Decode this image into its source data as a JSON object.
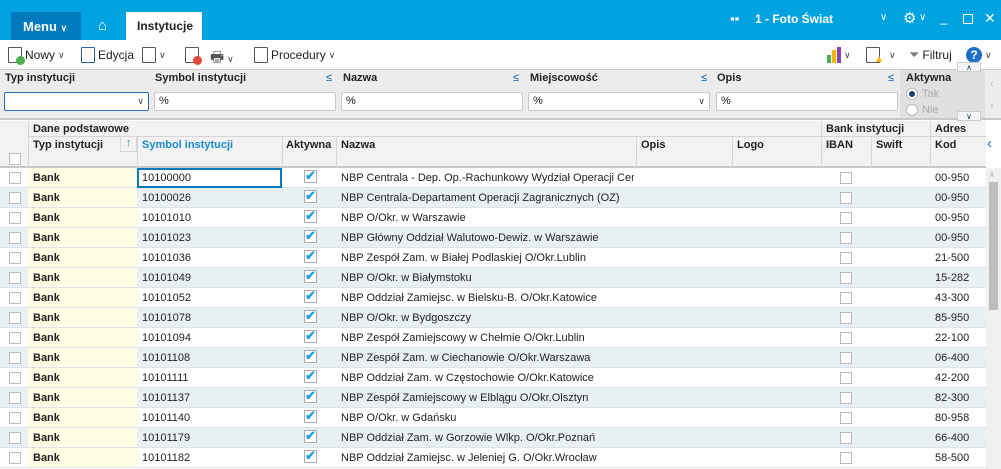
{
  "topbar": {
    "menu": "Menu",
    "tab": "Instytucje",
    "company": "1 - Foto Świat"
  },
  "toolbar": {
    "new": "Nowy",
    "edit": "Edycja",
    "procedures": "Procedury",
    "filter": "Filtruj"
  },
  "filters": {
    "typ": {
      "label": "Typ instytucji",
      "value": ""
    },
    "symbol": {
      "label": "Symbol instytucji",
      "value": "%"
    },
    "nazwa": {
      "label": "Nazwa",
      "value": "%"
    },
    "miejscowosc": {
      "label": "Miejscowość",
      "value": "%"
    },
    "opis": {
      "label": "Opis",
      "value": "%"
    },
    "aktywna": {
      "label": "Aktywna",
      "options": [
        "Tak",
        "Nie"
      ],
      "selected": "Tak"
    }
  },
  "grid": {
    "groups": {
      "basic": "Dane podstawowe",
      "bank": "Bank instytucji",
      "address": "Adres"
    },
    "columns": [
      "Typ instytucji",
      "Symbol instytucji",
      "Aktywna",
      "Nazwa",
      "Opis",
      "Logo",
      "IBAN",
      "Swift",
      "Kod"
    ],
    "rows": [
      [
        "Bank",
        "10100000",
        "NBP Centrala - Dep. Op.-Rachunkowy Wydział Operacji Centr",
        "00-950"
      ],
      [
        "Bank",
        "10100026",
        "NBP Centrala-Departament Operacji Zagranicznych (OZ)",
        "00-950"
      ],
      [
        "Bank",
        "10101010",
        "NBP O/Okr. w Warszawie",
        "00-950"
      ],
      [
        "Bank",
        "10101023",
        "NBP Główny Oddział Walutowo-Dewiz. w Warszawie",
        "00-950"
      ],
      [
        "Bank",
        "10101036",
        "NBP Zespół Zam. w Białej Podlaskiej O/Okr.Lublin",
        "21-500"
      ],
      [
        "Bank",
        "10101049",
        "NBP O/Okr. w Białymstoku",
        "15-282"
      ],
      [
        "Bank",
        "10101052",
        "NBP Oddział Zamiejsc. w Bielsku-B. O/Okr.Katowice",
        "43-300"
      ],
      [
        "Bank",
        "10101078",
        "NBP O/Okr. w Bydgoszczy",
        "85-950"
      ],
      [
        "Bank",
        "10101094",
        "NBP Zespół Zamiejscowy w Chełmie O/Okr.Lublin",
        "22-100"
      ],
      [
        "Bank",
        "10101108",
        "NBP Zespół Zam. w Ciechanowie O/Okr.Warszawa",
        "06-400"
      ],
      [
        "Bank",
        "10101111",
        "NBP Oddział Zam. w Częstochowie O/Okr.Katowice",
        "42-200"
      ],
      [
        "Bank",
        "10101137",
        "NBP Zespół Zamiejscowy w Elblągu O/Okr.Olsztyn",
        "82-300"
      ],
      [
        "Bank",
        "10101140",
        "NBP O/Okr. w Gdańsku",
        "80-958"
      ],
      [
        "Bank",
        "10101179",
        "NBP Oddział Zam. w Gorzowie Wlkp. O/Okr.Poznań",
        "66-400"
      ],
      [
        "Bank",
        "10101182",
        "NBP Oddział Zamiejsc. w Jeleniej G. O/Okr.Wrocław",
        "58-500"
      ]
    ]
  }
}
